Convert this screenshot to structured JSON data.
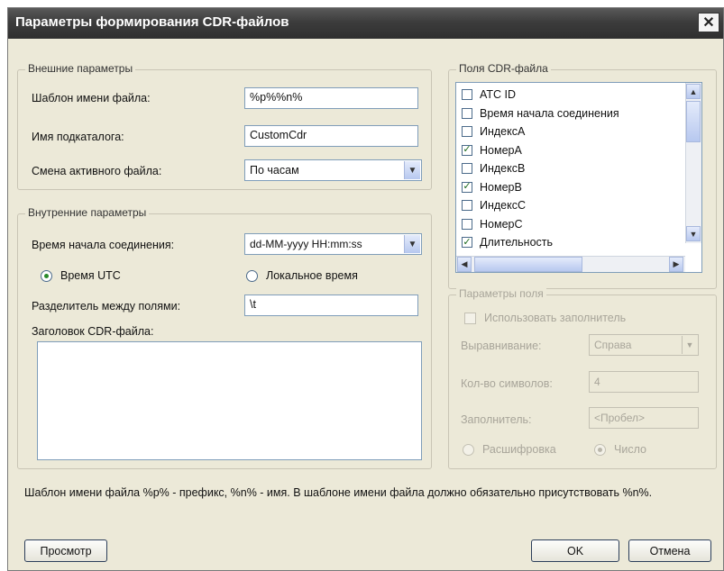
{
  "window": {
    "title": "Параметры формирования CDR-файлов",
    "close_symbol": "✕"
  },
  "external": {
    "group_title": "Внешние параметры",
    "filename_template_label": "Шаблон имени файла:",
    "filename_template_value": "%p%%n%",
    "subdir_label": "Имя подкаталога:",
    "subdir_value": "CustomCdr",
    "rotation_label": "Смена активного файла:",
    "rotation_value": "По часам"
  },
  "internal": {
    "group_title": "Внутренние параметры",
    "start_time_label": "Время начала соединения:",
    "start_time_format": "dd-MM-yyyy HH:mm:ss",
    "radio_utc": "Время UTC",
    "radio_utc_selected": true,
    "radio_local": "Локальное время",
    "radio_local_selected": false,
    "separator_label": "Разделитель между полями:",
    "separator_value": "\\t",
    "header_label": "Заголовок CDR-файла:",
    "header_value": ""
  },
  "cdr_fields": {
    "group_title": "Поля CDR-файла",
    "items": [
      {
        "label": "ATC ID",
        "checked": false
      },
      {
        "label": "Время начала соединения",
        "checked": false
      },
      {
        "label": "ИндексА",
        "checked": false
      },
      {
        "label": "НомерА",
        "checked": true
      },
      {
        "label": "ИндексВ",
        "checked": false
      },
      {
        "label": "НомерВ",
        "checked": true
      },
      {
        "label": "ИндексС",
        "checked": false
      },
      {
        "label": "НомерС",
        "checked": false
      },
      {
        "label": "Длительность",
        "checked": true
      }
    ]
  },
  "field_params": {
    "group_title": "Параметры поля",
    "use_filler_label": "Использовать заполнитель",
    "align_label": "Выравнивание:",
    "align_value": "Справа",
    "char_count_label": "Кол-во символов:",
    "char_count_value": "4",
    "filler_label": "Заполнитель:",
    "filler_value": "<Пробел>",
    "radio_decode": "Расшифровка",
    "radio_number": "Число"
  },
  "hint": "Шаблон имени файла %p% - префикс, %n% - имя. В шаблоне имени файла должно обязательно присутствовать %n%.",
  "buttons": {
    "preview": "Просмотр",
    "ok": "OK",
    "cancel": "Отмена"
  },
  "icons": {
    "dropdown": "chevron-down-icon",
    "check": "check-icon",
    "scroll_up": "arrow-up-icon",
    "scroll_down": "arrow-down-icon",
    "scroll_left": "arrow-left-icon",
    "scroll_right": "arrow-right-icon"
  }
}
